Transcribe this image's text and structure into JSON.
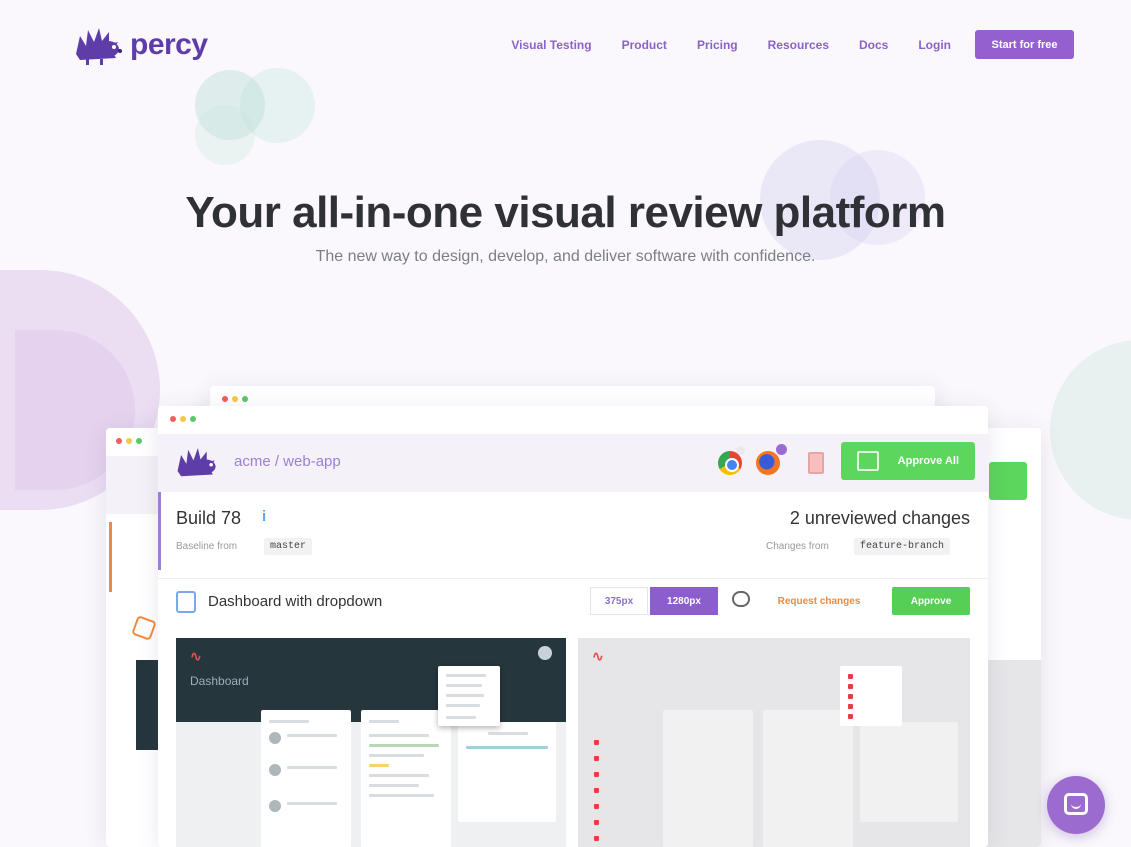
{
  "brand": {
    "name": "percy"
  },
  "nav": {
    "links": [
      "Visual Testing",
      "Product",
      "Pricing",
      "Resources",
      "Docs",
      "Login"
    ],
    "cta": "Start for free"
  },
  "hero": {
    "title": "Your all-in-one visual review platform",
    "subtitle": "The new way to design, develop, and deliver software with confidence."
  },
  "app": {
    "repo": "acme / web-app",
    "approve_all": "Approve All",
    "build": "Build 78",
    "baseline_label": "Baseline from",
    "baseline_branch": "master",
    "unreviewed": "2 unreviewed changes",
    "changes_label": "Changes from",
    "changes_branch": "feature-branch",
    "snapshot_title": "Dashboard with dropdown",
    "width_small": "375px",
    "width_large": "1280px",
    "request_changes": "Request changes",
    "approve": "Approve",
    "dashboard_label": "Dashboard"
  },
  "colors": {
    "brand": "#5f3da8",
    "accent": "#9460d0",
    "approve": "#5cd65c",
    "request": "#f08a3a"
  }
}
